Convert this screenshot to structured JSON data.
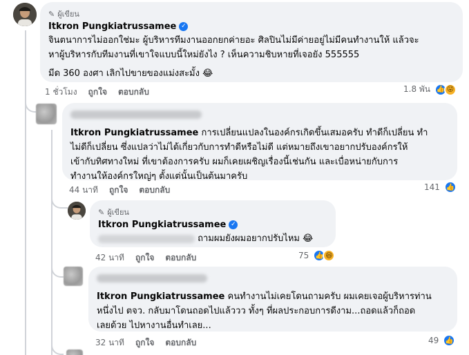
{
  "comment1": {
    "badge": "ผู้เขียน",
    "author": "Itkron Pungkiatrussamee",
    "line1": "จินตนาการไม่ออกใช่มะ ผู้บริหารทีมงานออกยกค่ายอะ ศิลปินไม่มีค่ายอยู่ไม่มีคนทำงานให้ แล้วจะ",
    "line2": "หาผู้บริหารกับทีมงานที่เขาใจแบบนี้ใหม่ยังไง ? เห็นความชิบหายที่เจอยัง 555555",
    "line3": "มีด 360 องศา เลิกไปขายของแม่งสะมั้ง 😂",
    "time": "1 ชั่วโมง",
    "like": "ถูกใจ",
    "reply": "ตอบกลับ",
    "reaction_count": "1.8 พัน"
  },
  "comment2": {
    "mention": "Itkron Pungkiatrussamee",
    "line1": " การเปลี่ยนแปลงในองค์กรเกิดขึ้นเสมอครับ ทำดีก็เปลี่ยน ทำ",
    "line2": "ไม่ดีก็เปลี่ยน ซึ่งแปลว่าไม่ได้เกี่ยวกับการทำดีหรือไม่ดี แต่หมายถึงเขาอยากปรับองค์กรให้",
    "line3": "เข้ากับทิศทางใหม่ ที่เขาต้องการครับ ผมก็เคยเผชิญเรื่องนี้เช่นกัน และเบื่อหน่ายกับการ",
    "line4": "ทำงานให้องค์กรใหญ่ๆ ตั้งแต่นั้นเป็นต้นมาครับ",
    "time": "44 นาที",
    "like": "ถูกใจ",
    "reply": "ตอบกลับ",
    "reaction_count": "141"
  },
  "comment3": {
    "badge": "ผู้เขียน",
    "author": "Itkron Pungkiatrussamee",
    "text": "ถามผมยังผมอยากปรับไหม 😂",
    "time": "42 นาที",
    "like": "ถูกใจ",
    "reply": "ตอบกลับ",
    "reaction_count": "75"
  },
  "comment4": {
    "mention": "Itkron Pungkiatrussamee",
    "line1": " คนทำงานไม่เคยโดนถามครับ ผมเคยเจอผู้บริหารท่าน",
    "line2": "หนึ่งไป ตจว. กลับมาโดนถอดไปแล้ววว ทั้งๆ ที่ผลประกอบการดีงาม...ถอดแล้วก็ถอด",
    "line3": "เลยด้วย ไปหางานอื่นทำเลย...",
    "time": "32 นาที",
    "like": "ถูกใจ",
    "reply": "ตอบกลับ",
    "reaction_count": "49"
  },
  "colors": {
    "accent": "#1877f2",
    "bubble": "#f0f2f5",
    "meta": "#65676b"
  }
}
